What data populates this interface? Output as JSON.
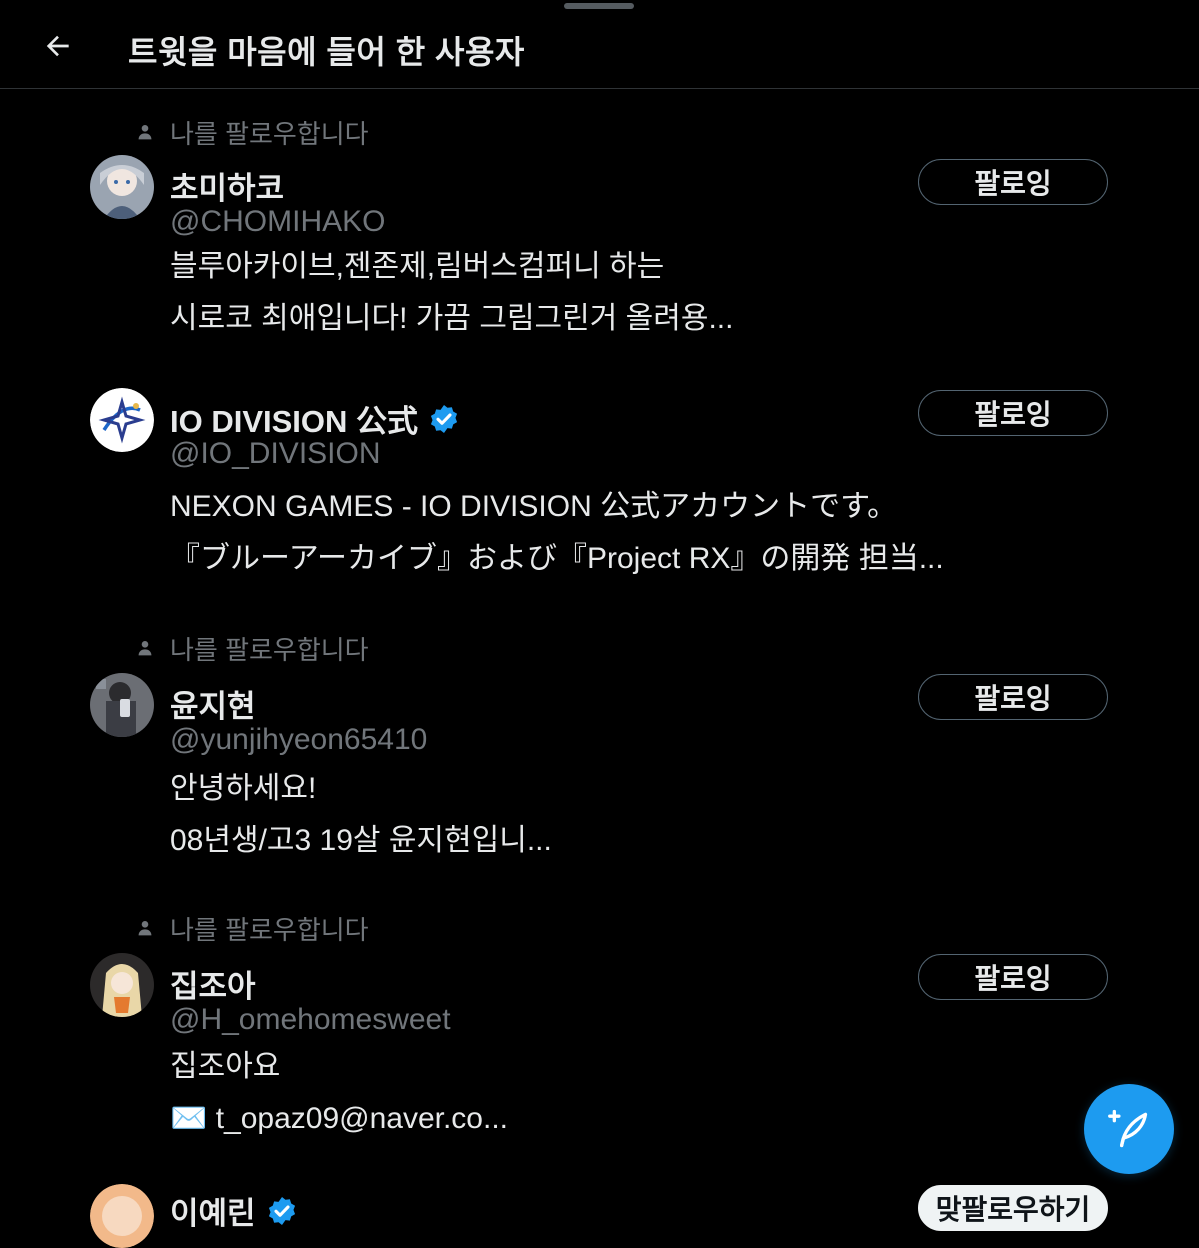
{
  "header": {
    "title": "트윗을 마음에 들어 한 사용자"
  },
  "users": [
    {
      "follows_you": "나를 팔로우합니다",
      "name": "초미하코",
      "handle": "@CHOMIHAKO",
      "bio_lines": [
        "블루아카이브,젠존제,림버스컴퍼니 하는",
        "시로코 최애입니다! 가끔 그림그린거 올려용..."
      ],
      "follow_label": "팔로잉"
    },
    {
      "name": "IO DIVISION 公式",
      "verified": true,
      "handle": "@IO_DIVISION",
      "bio_lines": [
        "NEXON GAMES - IO DIVISION 公式アカウントです。",
        "『ブルーアーカイブ』および『Project RX』の開発 担当..."
      ],
      "follow_label": "팔로잉"
    },
    {
      "follows_you": "나를 팔로우합니다",
      "name": "윤지현",
      "handle": "@yunjihyeon65410",
      "bio_lines": [
        "안녕하세요!",
        "08년생/고3 19살 윤지현입니..."
      ],
      "follow_label": "팔로잉"
    },
    {
      "follows_you": "나를 팔로우합니다",
      "name": "집조아",
      "handle": "@H_omehomesweet",
      "bio_lines": [
        "집조아요",
        "✉️ t_opaz09@naver.co..."
      ],
      "follow_label": "팔로잉"
    },
    {
      "name": "이예린",
      "verified": true,
      "follow_label": "맞팔로우하기"
    }
  ],
  "compose": {
    "icon": "compose-feather-plus-icon"
  },
  "colors": {
    "background": "#000000",
    "text_primary": "#e7e9ea",
    "text_secondary": "#71767b",
    "accent": "#1d9bf0",
    "button_border": "#536471"
  }
}
